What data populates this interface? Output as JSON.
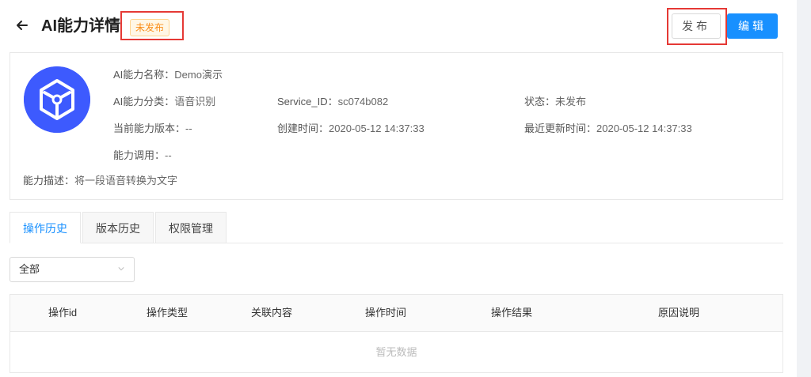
{
  "header": {
    "title": "AI能力详情",
    "status_badge": "未发布",
    "publish_label": "发布",
    "edit_label": "编辑"
  },
  "info": {
    "name_label": "AI能力名称：",
    "name_value": "Demo演示",
    "category_label": "AI能力分类：",
    "category_value": "语音识别",
    "service_id_label": "Service_ID：",
    "service_id_value": "sc074b082",
    "status_label": "状态：",
    "status_value": "未发布",
    "version_label": "当前能力版本：",
    "version_value": "--",
    "created_label": "创建时间：",
    "created_value": "2020-05-12 14:37:33",
    "updated_label": "最近更新时间：",
    "updated_value": "2020-05-12 14:37:33",
    "calls_label": "能力调用：",
    "calls_value": "--",
    "desc_label": "能力描述：",
    "desc_value": "将一段语音转换为文字"
  },
  "tabs": [
    {
      "label": "操作历史",
      "active": true
    },
    {
      "label": "版本历史",
      "active": false
    },
    {
      "label": "权限管理",
      "active": false
    }
  ],
  "filter": {
    "selected": "全部"
  },
  "table": {
    "columns": [
      "操作id",
      "操作类型",
      "关联内容",
      "操作时间",
      "操作结果",
      "原因说明"
    ],
    "empty_text": "暂无数据"
  },
  "colors": {
    "primary": "#1890ff",
    "badge_text": "#fa8c16",
    "logo_bg": "#3d5afe",
    "highlight_box": "#e53935"
  },
  "icons": [
    "back-arrow-icon",
    "cube-logo-icon",
    "chevron-down-icon"
  ]
}
